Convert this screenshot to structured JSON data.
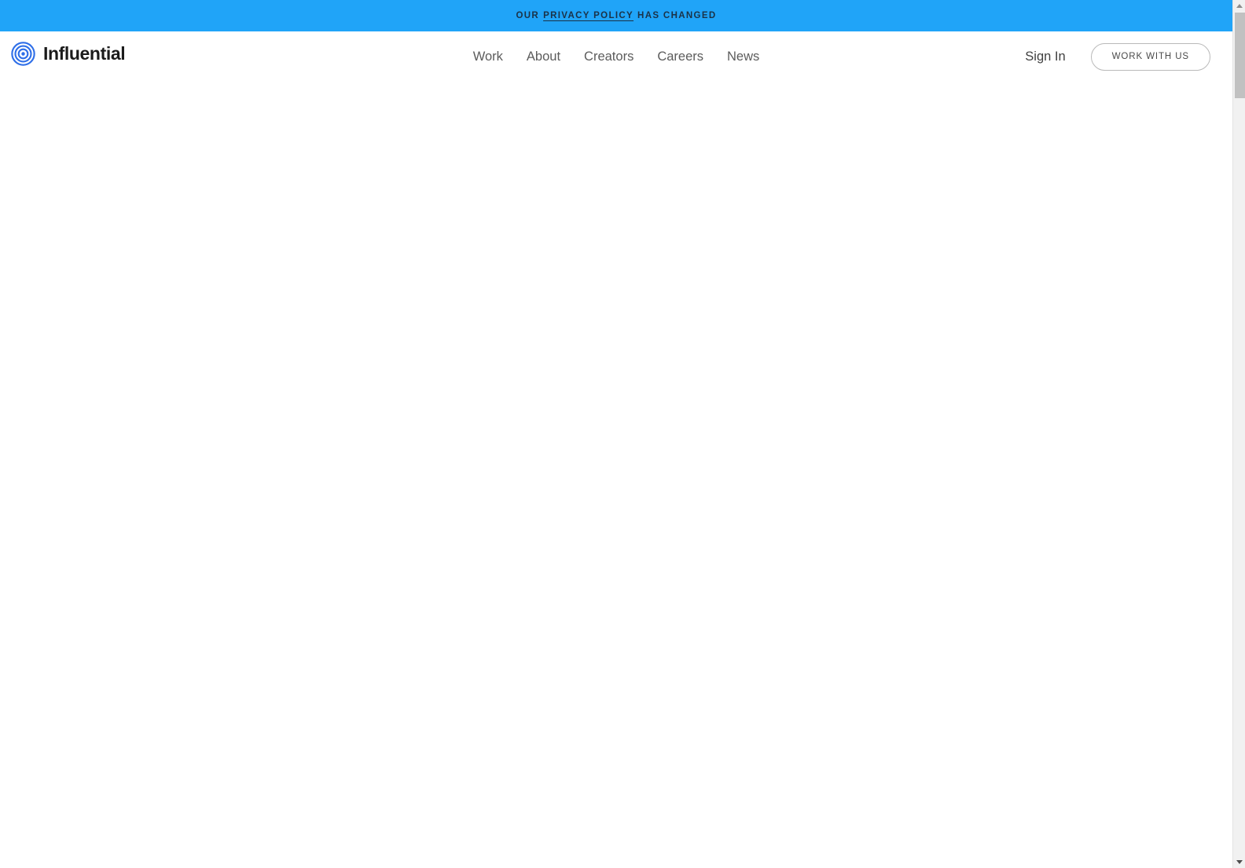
{
  "announcement": {
    "prefix": "OUR",
    "link_label": "PRIVACY POLICY",
    "suffix": "HAS CHANGED",
    "background_color": "#20a4f8",
    "text_color": "#1b3247"
  },
  "brand": {
    "name": "Influential",
    "logo_icon": "concentric-rings-icon",
    "logo_color": "#2563eb",
    "wordmark_color": "#1b1b1b"
  },
  "nav": {
    "items": [
      {
        "label": "Work"
      },
      {
        "label": "About"
      },
      {
        "label": "Creators"
      },
      {
        "label": "Careers"
      },
      {
        "label": "News"
      }
    ]
  },
  "actions": {
    "sign_in_label": "Sign In",
    "cta_label": "WORK WITH US"
  },
  "scrollbar": {
    "up_arrow_icon": "chevron-up-icon",
    "down_arrow_icon": "chevron-down-icon",
    "thumb_color": "#c1c1c1",
    "track_color": "#f1f1f1"
  }
}
